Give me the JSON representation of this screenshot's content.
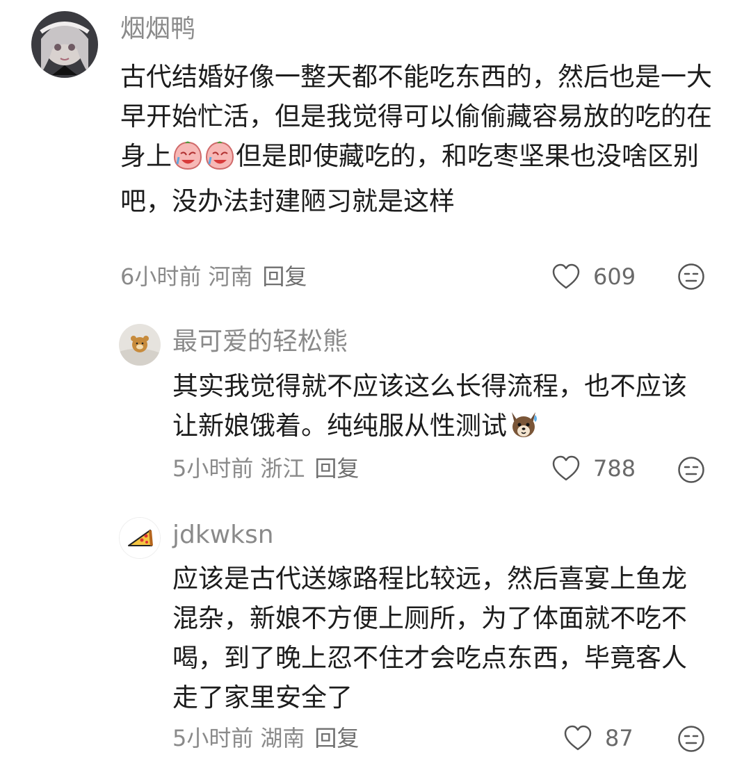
{
  "comments": [
    {
      "username": "烟烟鸭",
      "text_parts": [
        "古代结婚好像一整天都不能吃东西的，然后也是一大早开始忙活，但是我觉得可以偷偷藏容易放的吃的在身上",
        "但是即使藏吃的，和吃枣坚果也没啥区别吧，没办法封建陋习就是这样"
      ],
      "emoji": "crying-face-emoji",
      "time": "6小时前",
      "location": "河南",
      "reply_label": "回复",
      "likes": "609"
    },
    {
      "username": "最可爱的轻松熊",
      "text_parts": [
        "其实我觉得就不应该这么长得流程，也不应该让新娘饿着。纯纯服从性测试",
        ""
      ],
      "emoji": "sweating-dog-emoji",
      "time": "5小时前",
      "location": "浙江",
      "reply_label": "回复",
      "likes": "788"
    },
    {
      "username": "jdkwksn",
      "text_parts": [
        "应该是古代送嫁路程比较远，然后喜宴上鱼龙混杂，新娘不方便上厕所，为了体面就不吃不喝，到了晚上忍不住才会吃点东西，毕竟客人走了家里安全了"
      ],
      "time": "5小时前",
      "location": "湖南",
      "reply_label": "回复",
      "likes": "87"
    }
  ],
  "colors": {
    "muted": "#8a8a8a",
    "text": "#1c1c1c",
    "icon": "#555555"
  }
}
